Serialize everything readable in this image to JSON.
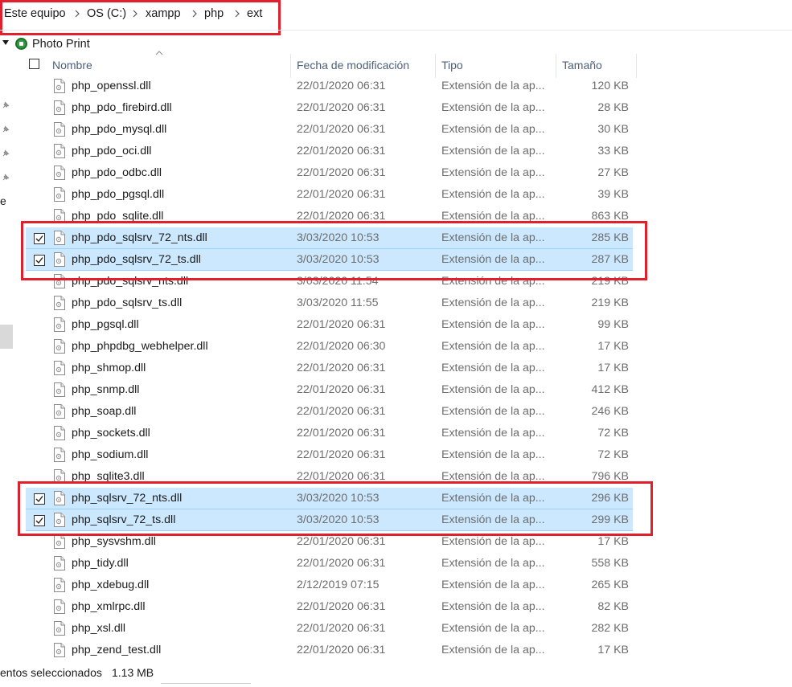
{
  "breadcrumb": [
    "Este equipo",
    "OS (C:)",
    "xampp",
    "php",
    "ext"
  ],
  "tree": {
    "label": "Photo Print"
  },
  "nav": {
    "cut_label": "e"
  },
  "columns": {
    "name": "Nombre",
    "date": "Fecha de modificación",
    "type": "Tipo",
    "size": "Tamaño"
  },
  "files": [
    {
      "name": "php_openssl.dll",
      "date": "22/01/2020 06:31",
      "type": "Extensión de la ap...",
      "size": "120 KB",
      "selected": false
    },
    {
      "name": "php_pdo_firebird.dll",
      "date": "22/01/2020 06:31",
      "type": "Extensión de la ap...",
      "size": "28 KB",
      "selected": false
    },
    {
      "name": "php_pdo_mysql.dll",
      "date": "22/01/2020 06:31",
      "type": "Extensión de la ap...",
      "size": "30 KB",
      "selected": false
    },
    {
      "name": "php_pdo_oci.dll",
      "date": "22/01/2020 06:31",
      "type": "Extensión de la ap...",
      "size": "33 KB",
      "selected": false
    },
    {
      "name": "php_pdo_odbc.dll",
      "date": "22/01/2020 06:31",
      "type": "Extensión de la ap...",
      "size": "27 KB",
      "selected": false
    },
    {
      "name": "php_pdo_pgsql.dll",
      "date": "22/01/2020 06:31",
      "type": "Extensión de la ap...",
      "size": "39 KB",
      "selected": false
    },
    {
      "name": "php_pdo_sqlite.dll",
      "date": "22/01/2020 06:31",
      "type": "Extensión de la ap...",
      "size": "863 KB",
      "selected": false
    },
    {
      "name": "php_pdo_sqlsrv_72_nts.dll",
      "date": "3/03/2020 10:53",
      "type": "Extensión de la ap...",
      "size": "285 KB",
      "selected": true
    },
    {
      "name": "php_pdo_sqlsrv_72_ts.dll",
      "date": "3/03/2020 10:53",
      "type": "Extensión de la ap...",
      "size": "287 KB",
      "selected": true
    },
    {
      "name": "php_pdo_sqlsrv_nts.dll",
      "date": "3/03/2020 11:54",
      "type": "Extensión de la ap...",
      "size": "219 KB",
      "selected": false
    },
    {
      "name": "php_pdo_sqlsrv_ts.dll",
      "date": "3/03/2020 11:55",
      "type": "Extensión de la ap...",
      "size": "219 KB",
      "selected": false
    },
    {
      "name": "php_pgsql.dll",
      "date": "22/01/2020 06:31",
      "type": "Extensión de la ap...",
      "size": "99 KB",
      "selected": false
    },
    {
      "name": "php_phpdbg_webhelper.dll",
      "date": "22/01/2020 06:30",
      "type": "Extensión de la ap...",
      "size": "17 KB",
      "selected": false
    },
    {
      "name": "php_shmop.dll",
      "date": "22/01/2020 06:31",
      "type": "Extensión de la ap...",
      "size": "17 KB",
      "selected": false
    },
    {
      "name": "php_snmp.dll",
      "date": "22/01/2020 06:31",
      "type": "Extensión de la ap...",
      "size": "412 KB",
      "selected": false
    },
    {
      "name": "php_soap.dll",
      "date": "22/01/2020 06:31",
      "type": "Extensión de la ap...",
      "size": "246 KB",
      "selected": false
    },
    {
      "name": "php_sockets.dll",
      "date": "22/01/2020 06:31",
      "type": "Extensión de la ap...",
      "size": "72 KB",
      "selected": false
    },
    {
      "name": "php_sodium.dll",
      "date": "22/01/2020 06:31",
      "type": "Extensión de la ap...",
      "size": "72 KB",
      "selected": false
    },
    {
      "name": "php_sqlite3.dll",
      "date": "22/01/2020 06:31",
      "type": "Extensión de la ap...",
      "size": "796 KB",
      "selected": false
    },
    {
      "name": "php_sqlsrv_72_nts.dll",
      "date": "3/03/2020 10:53",
      "type": "Extensión de la ap...",
      "size": "296 KB",
      "selected": true
    },
    {
      "name": "php_sqlsrv_72_ts.dll",
      "date": "3/03/2020 10:53",
      "type": "Extensión de la ap...",
      "size": "299 KB",
      "selected": true
    },
    {
      "name": "php_sysvshm.dll",
      "date": "22/01/2020 06:31",
      "type": "Extensión de la ap...",
      "size": "17 KB",
      "selected": false
    },
    {
      "name": "php_tidy.dll",
      "date": "22/01/2020 06:31",
      "type": "Extensión de la ap...",
      "size": "558 KB",
      "selected": false
    },
    {
      "name": "php_xdebug.dll",
      "date": "2/12/2019 07:15",
      "type": "Extensión de la ap...",
      "size": "265 KB",
      "selected": false
    },
    {
      "name": "php_xmlrpc.dll",
      "date": "22/01/2020 06:31",
      "type": "Extensión de la ap...",
      "size": "82 KB",
      "selected": false
    },
    {
      "name": "php_xsl.dll",
      "date": "22/01/2020 06:31",
      "type": "Extensión de la ap...",
      "size": "282 KB",
      "selected": false
    },
    {
      "name": "php_zend_test.dll",
      "date": "22/01/2020 06:31",
      "type": "Extensión de la ap...",
      "size": "17 KB",
      "selected": false
    }
  ],
  "status": {
    "selected_text": "entos seleccionados",
    "selected_size": "1.13 MB"
  },
  "icons": {
    "file": "dll-file-icon",
    "pin": "pin-icon",
    "separator": "chevron-right-icon",
    "tree": "photo-print-icon"
  },
  "colors": {
    "highlight_box": "#e0202c",
    "selection": "#cce8ff",
    "header_text": "#4c607a"
  }
}
